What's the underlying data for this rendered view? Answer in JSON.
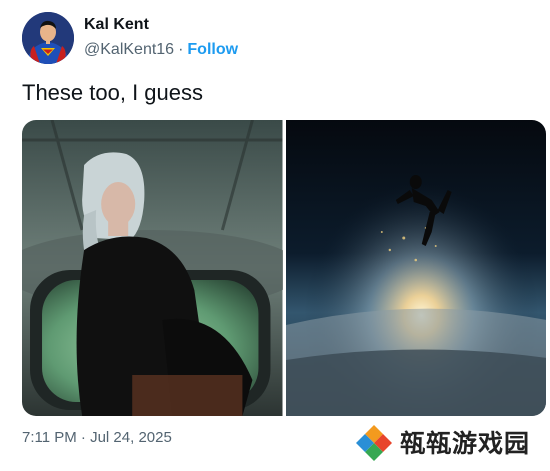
{
  "author": {
    "name": "Kal Kent",
    "handle": "@KalKent16",
    "separator": "·",
    "follow_label": "Follow",
    "avatar_icon": "superman-avatar"
  },
  "tweet": {
    "text": "These too, I guess",
    "timestamp": "7:11 PM · Jul 24, 2025"
  },
  "media": {
    "photos": [
      {
        "subject": "woman-in-spaceship-window"
      },
      {
        "subject": "figure-falling-above-planet"
      }
    ]
  },
  "watermark": {
    "text": "𤭢𤭢游戏园",
    "icon": "diamond-logo-icon"
  },
  "colors": {
    "accent": "#1d9bf0",
    "text_primary": "#0f1419",
    "text_secondary": "#536471"
  }
}
